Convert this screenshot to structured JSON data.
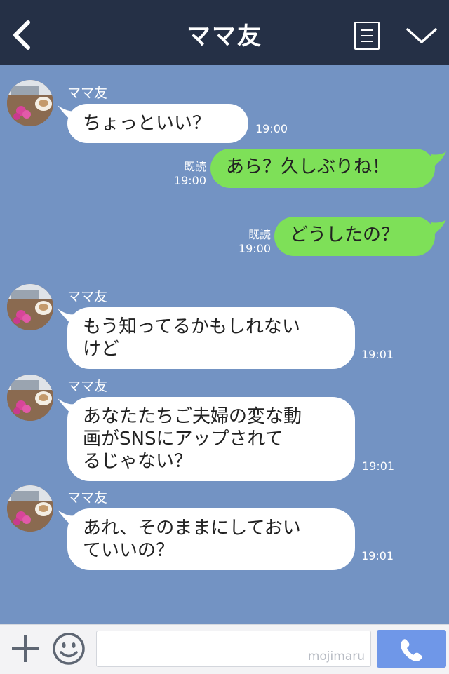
{
  "header": {
    "title": "ママ友",
    "back_icon": "chevron-left-icon",
    "menu_icon": "menu-list-icon",
    "collapse_icon": "chevron-down-icon"
  },
  "messages": [
    {
      "side": "in",
      "sender": "ママ友",
      "text": "ちょっといい？",
      "time": "19:00"
    },
    {
      "side": "out",
      "read": "既読",
      "text": "あら？久しぶりね！",
      "time": "19:00"
    },
    {
      "side": "out",
      "read": "既読",
      "text": "どうしたの？",
      "time": "19:00"
    },
    {
      "side": "in",
      "sender": "ママ友",
      "text": "もう知ってるかもしれない\nけど",
      "time": "19:01"
    },
    {
      "side": "in",
      "sender": "ママ友",
      "text": "あなたたちご夫婦の変な動\n画がSNSにアップされて\nるじゃない？",
      "time": "19:01"
    },
    {
      "side": "in",
      "sender": "ママ友",
      "text": "あれ、そのままにしておい\nていいの？",
      "time": "19:01"
    }
  ],
  "footer": {
    "plus_icon": "plus-icon",
    "sticker_icon": "smiley-icon",
    "input_value": "",
    "watermark": "mojimaru",
    "call_icon": "phone-icon"
  },
  "colors": {
    "header_bg": "#253046",
    "chat_bg": "#7393c3",
    "incoming_bubble": "#ffffff",
    "outgoing_bubble": "#7ee058",
    "call_button": "#6f97e8"
  }
}
